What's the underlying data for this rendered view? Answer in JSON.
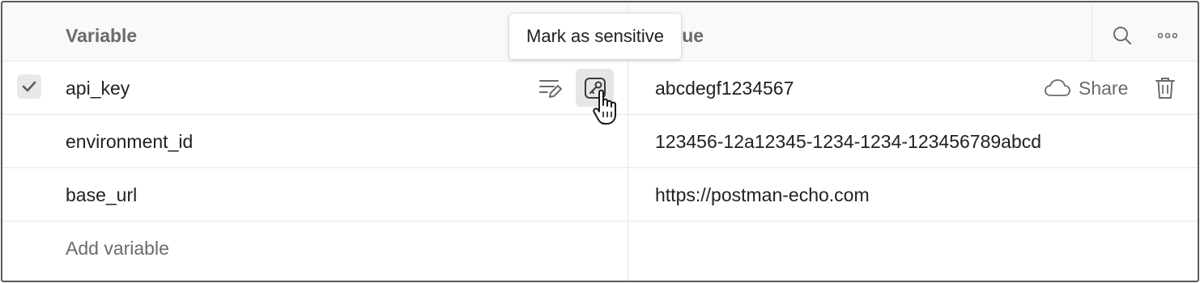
{
  "table": {
    "columns": {
      "variable": "Variable",
      "value": "Value"
    },
    "rows": [
      {
        "variable": "api_key",
        "value": "abcdegf1234567",
        "selected": true
      },
      {
        "variable": "environment_id",
        "value": "123456-12a12345-1234-1234-123456789abcd"
      },
      {
        "variable": "base_url",
        "value": "https://postman-echo.com"
      }
    ],
    "add_placeholder": "Add variable",
    "share_label": "Share"
  },
  "tooltip": {
    "text": "Mark as sensitive"
  },
  "icons": {
    "search": "search-icon",
    "more": "more-horizontal-icon",
    "checkbox": "checkmark-icon",
    "edit": "edit-lines-icon",
    "key": "key-icon",
    "cursor": "hand-cursor-icon",
    "cloud": "cloud-icon",
    "trash": "trash-icon"
  },
  "colors": {
    "header_bg": "#f9f9f9",
    "text": "#212121",
    "muted": "#6b6b6b",
    "border": "#5a5a5a"
  }
}
